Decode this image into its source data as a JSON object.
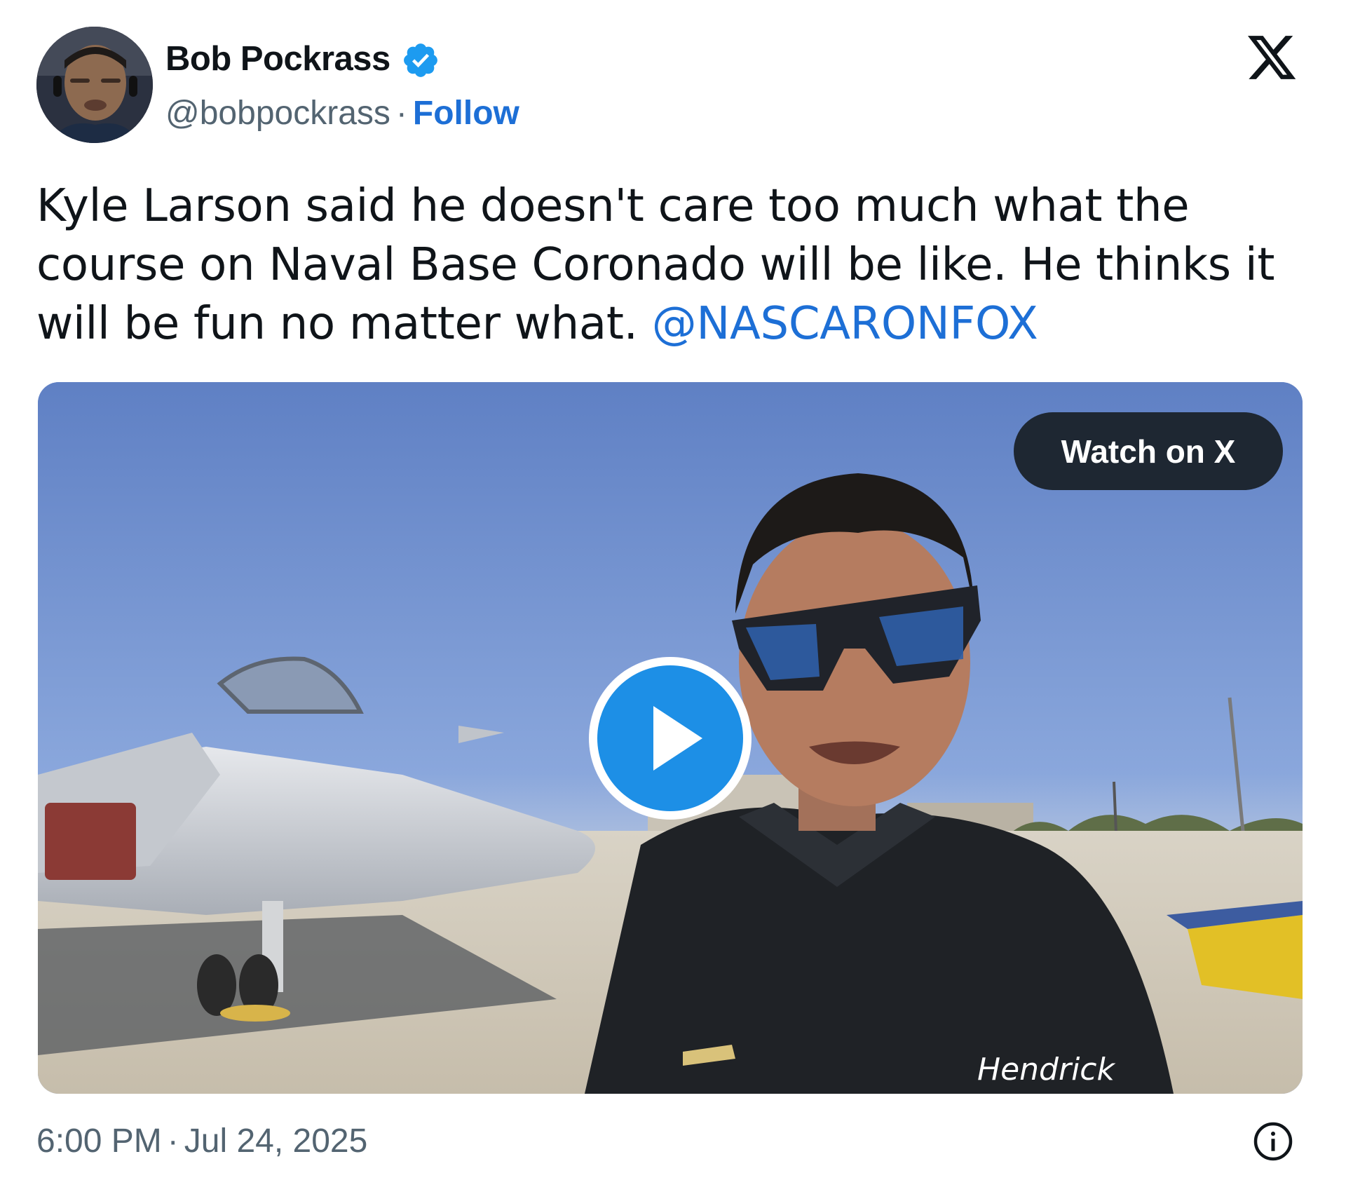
{
  "author": {
    "name": "Bob Pockrass",
    "handle": "@bobpockrass",
    "separator": "·",
    "follow_label": "Follow",
    "verified_icon": "verified-badge-icon"
  },
  "header": {
    "logo_icon": "x-logo-icon"
  },
  "tweet": {
    "text": "Kyle Larson said he doesn't care too much what the course on Naval Base Coronado will be like. He thinks it will be fun no matter what. ",
    "mention": "@NASCARONFOX"
  },
  "media": {
    "watch_label": "Watch on X",
    "play_icon": "play-icon",
    "shirt_brand": "Hendrick"
  },
  "footer": {
    "time": "6:00 PM",
    "separator": "·",
    "date": "Jul 24, 2025",
    "info_icon": "info-icon"
  },
  "colors": {
    "accent": "#1d6fd6",
    "verified": "#1d9bf0",
    "play": "#1d8fe6",
    "watch_button_bg": "#1e2732",
    "muted_text": "#536471"
  }
}
